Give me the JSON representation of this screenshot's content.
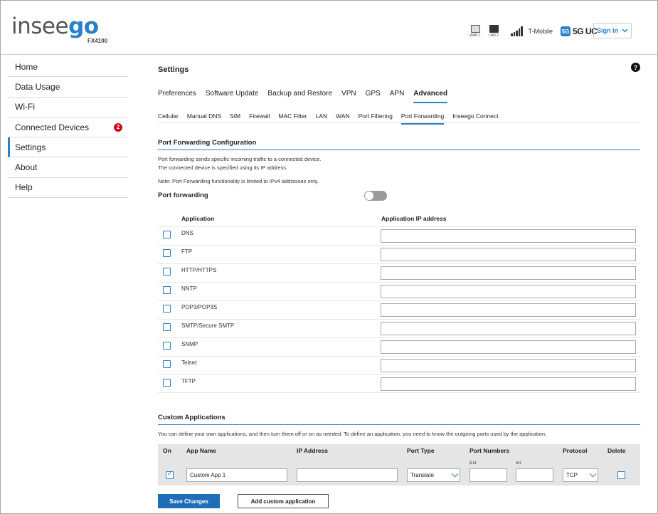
{
  "header": {
    "logo_main": "insee",
    "logo_accent": "go",
    "model": "FX4100",
    "wan_label": "WAN 1",
    "lan_label": "LAN 2",
    "carrier": "T-Mobile",
    "network_badge": "5G",
    "network_text": "5G UC",
    "signin_label": "Sign In"
  },
  "sidebar": {
    "items": [
      {
        "label": "Home"
      },
      {
        "label": "Data Usage"
      },
      {
        "label": "Wi-Fi"
      },
      {
        "label": "Connected Devices",
        "badge": "2"
      },
      {
        "label": "Settings",
        "active": true
      },
      {
        "label": "About"
      },
      {
        "label": "Help"
      }
    ]
  },
  "page": {
    "title": "Settings",
    "help": "?",
    "tabs": [
      "Preferences",
      "Software Update",
      "Backup and Restore",
      "VPN",
      "GPS",
      "APN",
      "Advanced"
    ],
    "active_tab": "Advanced",
    "subtabs": [
      "Cellular",
      "Manual DNS",
      "SIM",
      "Firewall",
      "MAC Filter",
      "LAN",
      "WAN",
      "Port Filtering",
      "Port Forwarding",
      "Inseego Connect"
    ],
    "active_subtab": "Port Forwarding"
  },
  "port_forwarding": {
    "section_title": "Port Forwarding Configuration",
    "desc_line1": "Port forwarding sends specific incoming traffic to a connected device.",
    "desc_line2": "The connected device is specified using its IP address.",
    "note": "Note: Port Forwarding functionality is limited to IPv4 addresses only.",
    "toggle_label": "Port forwarding",
    "toggle_on": false,
    "col_application": "Application",
    "col_ip": "Application IP address",
    "apps": [
      "DNS",
      "FTP",
      "HTTP/HTTPS",
      "NNTP",
      "POP3/POP3S",
      "SMTP/Secure SMTP",
      "SNMP",
      "Telnet",
      "TFTP"
    ]
  },
  "custom": {
    "section_title": "Custom Applications",
    "desc": "You can define your own applications, and then turn them off or on as needed. To define an application, you need to know the outgoing ports used by the application.",
    "col_on": "On",
    "col_app_name": "App Name",
    "col_ip": "IP Address",
    "col_port_type": "Port Type",
    "col_port_numbers": "Port Numbers",
    "col_ext": "Ext",
    "col_int": "Int",
    "col_protocol": "Protocol",
    "col_delete": "Delete",
    "row": {
      "on": true,
      "app_name": "Custom App 1",
      "ip": "",
      "port_type": "Translate",
      "ext": "",
      "int": "",
      "protocol": "TCP",
      "delete": false
    }
  },
  "buttons": {
    "save": "Save Changes",
    "add": "Add custom application"
  },
  "colors": {
    "accent": "#2a7fc9",
    "primary_button": "#1f6fb8",
    "badge": "#d0021b"
  }
}
